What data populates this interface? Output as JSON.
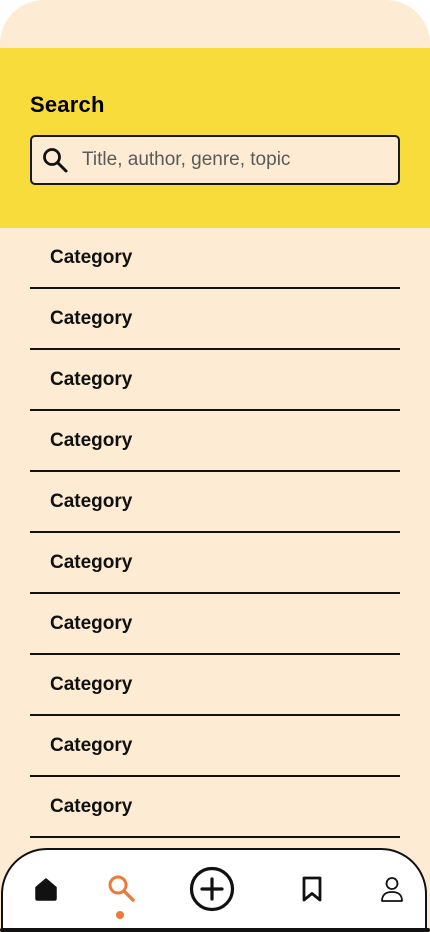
{
  "header": {
    "title": "Search"
  },
  "search": {
    "placeholder": "Title, author, genre, topic",
    "value": ""
  },
  "categories": [
    {
      "label": "Category"
    },
    {
      "label": "Category"
    },
    {
      "label": "Category"
    },
    {
      "label": "Category"
    },
    {
      "label": "Category"
    },
    {
      "label": "Category"
    },
    {
      "label": "Category"
    },
    {
      "label": "Category"
    },
    {
      "label": "Category"
    },
    {
      "label": "Category"
    }
  ],
  "nav": {
    "items": [
      {
        "icon": "home-icon",
        "active": false
      },
      {
        "icon": "search-icon",
        "active": true
      },
      {
        "icon": "plus-circle-icon",
        "active": false
      },
      {
        "icon": "bookmark-icon",
        "active": false
      },
      {
        "icon": "user-icon",
        "active": false
      }
    ]
  },
  "colors": {
    "background": "#FDEBD3",
    "header_bg": "#F7DC3C",
    "accent": "#EE7A3A",
    "text": "#111111"
  }
}
